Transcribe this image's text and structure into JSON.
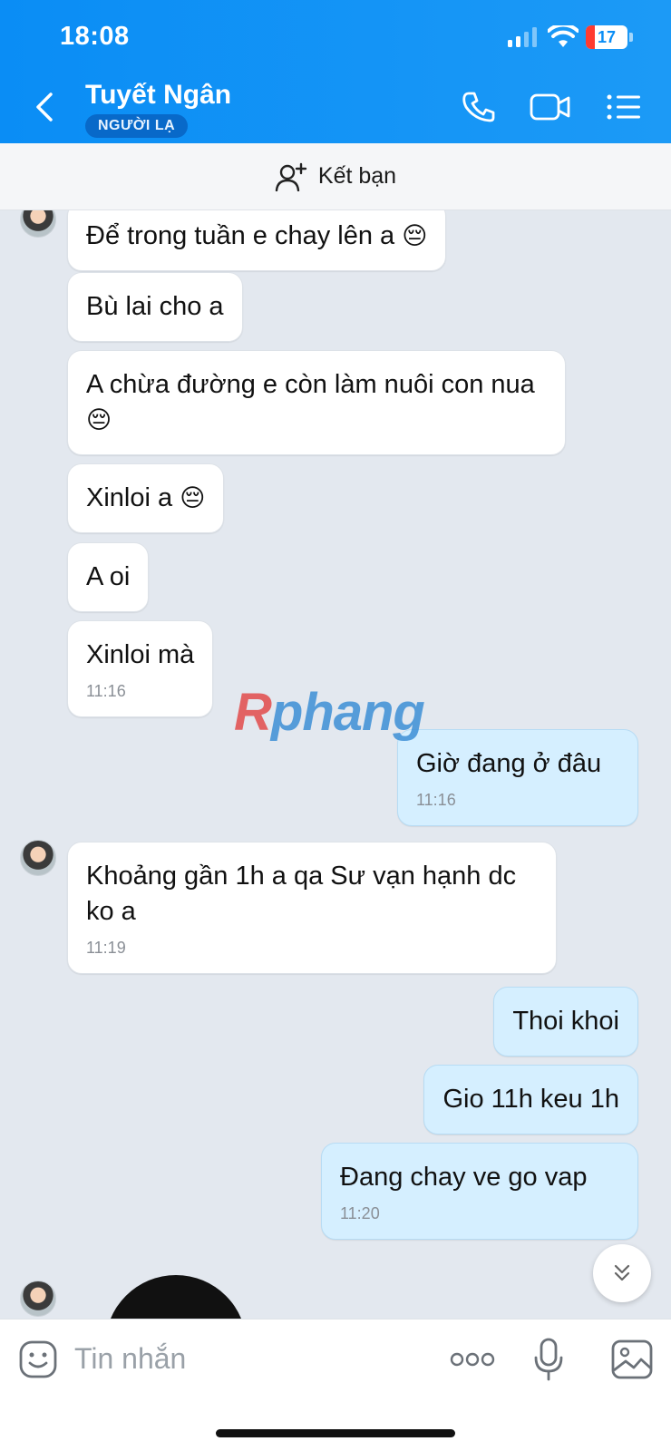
{
  "status_bar": {
    "time": "18:08",
    "battery": "17"
  },
  "header": {
    "contact_name": "Tuyết Ngân",
    "badge": "NGƯỜI LẠ"
  },
  "friend_bar": {
    "label": "Kết bạn"
  },
  "messages": [
    {
      "dir": "in",
      "text": "Để trong tuần e chay lên a",
      "emoji": "😔"
    },
    {
      "dir": "in",
      "text": "Bù lai cho a"
    },
    {
      "dir": "in",
      "text": "A chừa đường e còn làm nuôi con nua",
      "emoji": "😔"
    },
    {
      "dir": "in",
      "text": "Xinloi a",
      "emoji": "😔"
    },
    {
      "dir": "in",
      "text": "A oi"
    },
    {
      "dir": "in",
      "text": "Xinloi mà",
      "time": "11:16"
    },
    {
      "dir": "out",
      "text": "Giờ đang ở đâu",
      "time": "11:16"
    },
    {
      "dir": "in",
      "text": "Khoảng gần 1h a qa Sư vạn hạnh dc ko a",
      "time": "11:19"
    },
    {
      "dir": "out",
      "text": "Thoi khoi"
    },
    {
      "dir": "out",
      "text": "Gio 11h keu 1h"
    },
    {
      "dir": "out",
      "text": "Đang chay ve go vap",
      "time": "11:20"
    }
  ],
  "watermark": {
    "first": "R",
    "rest": "phang"
  },
  "input": {
    "placeholder": "Tin nhắn"
  },
  "icons": {
    "back": "chevron-left-icon",
    "call": "phone-icon",
    "video": "video-camera-icon",
    "menu": "list-icon",
    "add_friend": "add-user-icon",
    "sticker": "sticker-smile-icon",
    "more": "more-dots-icon",
    "mic": "microphone-icon",
    "image": "image-icon",
    "scroll": "double-chevron-down-icon"
  },
  "colors": {
    "header": "#0a8df5",
    "incoming_bubble": "#ffffff",
    "outgoing_bubble": "#d5efff",
    "chat_bg": "#e3e8ef"
  }
}
